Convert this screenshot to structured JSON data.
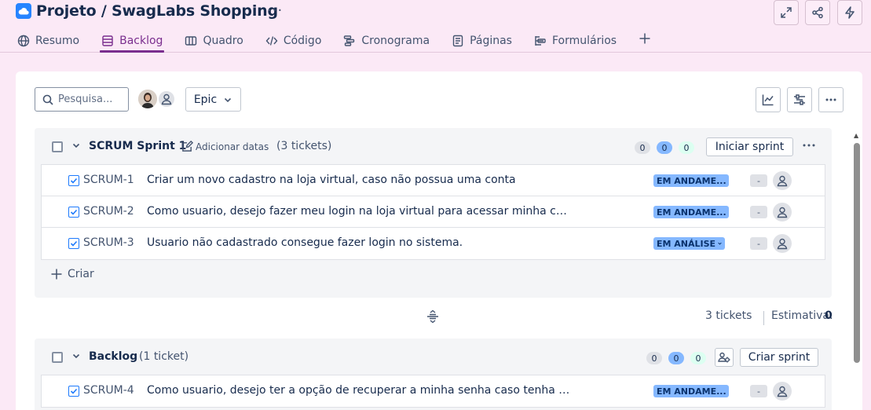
{
  "header": {
    "title": "Projeto / SwagLabs Shopping",
    "more_label": "···",
    "actions": [
      {
        "name": "fullscreen-icon"
      },
      {
        "name": "share-icon"
      },
      {
        "name": "lightning-icon"
      }
    ]
  },
  "tabs": [
    {
      "label": "Resumo",
      "icon": "globe-icon",
      "active": false
    },
    {
      "label": "Backlog",
      "icon": "list-icon",
      "active": true
    },
    {
      "label": "Quadro",
      "icon": "board-icon",
      "active": false
    },
    {
      "label": "Código",
      "icon": "code-icon",
      "active": false
    },
    {
      "label": "Cronograma",
      "icon": "timeline-icon",
      "active": false
    },
    {
      "label": "Páginas",
      "icon": "page-icon",
      "active": false
    },
    {
      "label": "Formulários",
      "icon": "form-icon",
      "active": false
    }
  ],
  "toolbar": {
    "search_placeholder": "Pesquisa...",
    "epic_label": "Epic"
  },
  "sprint": {
    "name": "SCRUM Sprint 1",
    "add_dates": "Adicionar datas",
    "count": "(3 tickets)",
    "pills": [
      "0",
      "0",
      "0"
    ],
    "start_label": "Iniciar sprint",
    "issues": [
      {
        "key": "SCRUM-1",
        "summary": "Criar um novo cadastro na loja virtual, caso não possua uma conta",
        "status": "EM ANDAME...",
        "estimate": "-"
      },
      {
        "key": "SCRUM-2",
        "summary": "Como usuario, desejo fazer meu login na loja virtual para acessar minha con...",
        "status": "EM ANDAME...",
        "estimate": "-"
      },
      {
        "key": "SCRUM-3",
        "summary": "Usuario não cadastrado consegue fazer login no sistema.",
        "status": "EM ANÁLISE",
        "estimate": "-"
      }
    ],
    "create_label": "Criar"
  },
  "summary": {
    "tickets": "3 tickets",
    "estimate_label": "Estimativa:",
    "estimate_value": "0"
  },
  "backlog": {
    "name": "Backlog",
    "count": "(1 ticket)",
    "pills": [
      "0",
      "0",
      "0"
    ],
    "create_sprint_label": "Criar sprint",
    "issues": [
      {
        "key": "SCRUM-4",
        "summary": "Como usuario, desejo ter a opção de recuperar a minha senha caso tenha es...",
        "status": "EM ANDAME...",
        "estimate": "-"
      }
    ]
  },
  "colors": {
    "page_bg": "#fbe9f6",
    "accent": "#7a2e8e",
    "status_bg": "#85b8ff",
    "status_text": "#09326c"
  }
}
